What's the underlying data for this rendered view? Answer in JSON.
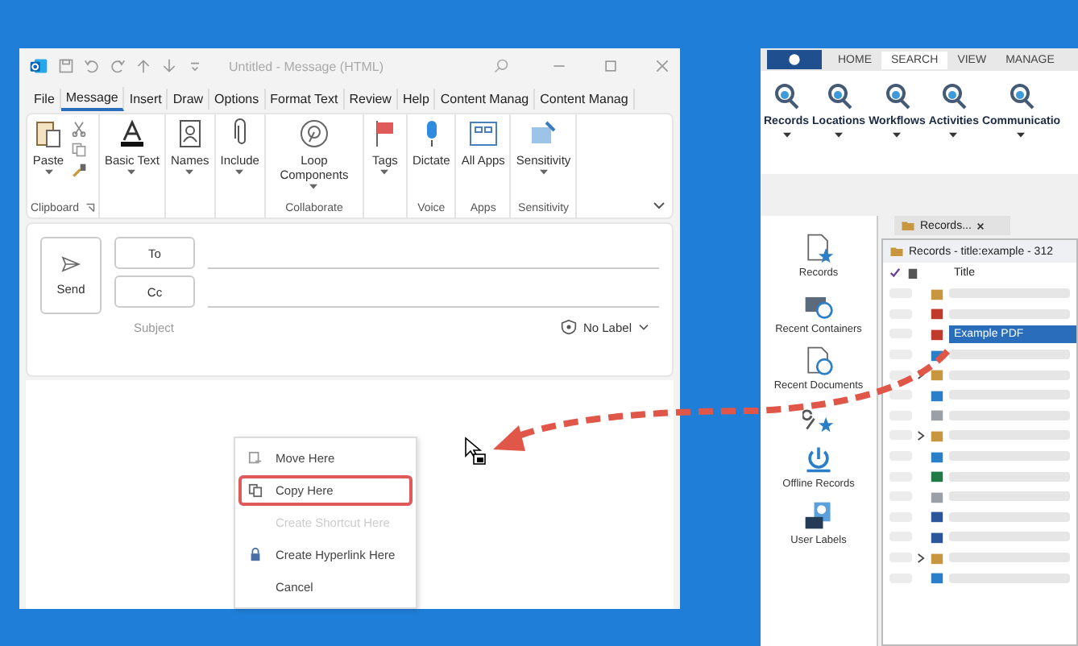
{
  "outlook": {
    "title": "Untitled - Message (HTML)",
    "tabs": [
      {
        "label": "File",
        "selected": false
      },
      {
        "label": "Message",
        "selected": true
      },
      {
        "label": "Insert",
        "selected": false
      },
      {
        "label": "Draw",
        "selected": false
      },
      {
        "label": "Options",
        "selected": false
      },
      {
        "label": "Format Text",
        "selected": false
      },
      {
        "label": "Review",
        "selected": false
      },
      {
        "label": "Help",
        "selected": false
      },
      {
        "label": "Content Manag",
        "selected": false
      },
      {
        "label": "Content Manag",
        "selected": false
      }
    ],
    "ribbon_groups": [
      {
        "label": "Clipboard",
        "launcher": true,
        "buttons": [
          {
            "kind": "large",
            "label": "Paste",
            "dropdown": true
          },
          {
            "kind": "small"
          },
          {
            "kind": "small"
          },
          {
            "kind": "small"
          }
        ]
      },
      {
        "buttons": [
          {
            "kind": "large",
            "label": "Basic Text",
            "dropdown": true
          }
        ]
      },
      {
        "buttons": [
          {
            "kind": "large",
            "label": "Names",
            "dropdown": true
          }
        ]
      },
      {
        "buttons": [
          {
            "kind": "large",
            "label": "Include",
            "dropdown": true
          }
        ]
      },
      {
        "label": "Collaborate",
        "buttons": [
          {
            "kind": "large",
            "label": "Loop Components",
            "dropdown": true
          }
        ]
      },
      {
        "buttons": [
          {
            "kind": "large",
            "label": "Tags",
            "dropdown": true
          }
        ]
      },
      {
        "label": "Voice",
        "buttons": [
          {
            "kind": "large",
            "label": "Dictate",
            "dropdown": false
          }
        ]
      },
      {
        "label": "Apps",
        "buttons": [
          {
            "kind": "large",
            "label": "All Apps",
            "dropdown": false
          }
        ]
      },
      {
        "label": "Sensitivity",
        "buttons": [
          {
            "kind": "large",
            "label": "Sensitivity",
            "dropdown": true
          }
        ]
      }
    ],
    "compose": {
      "send": "Send",
      "to": "To",
      "cc": "Cc",
      "subject": "Subject",
      "sensitivity": "No Label"
    },
    "context_menu": [
      {
        "label": "Move Here",
        "disabled": false,
        "selected": false
      },
      {
        "label": "Copy Here",
        "disabled": false,
        "selected": true
      },
      {
        "label": "Create Shortcut Here",
        "disabled": true,
        "selected": false
      },
      {
        "label": "Create Hyperlink Here",
        "disabled": false,
        "selected": false
      },
      {
        "label": "Cancel",
        "disabled": false,
        "selected": false
      }
    ]
  },
  "records_app": {
    "tabs": [
      {
        "label": "HOME",
        "selected": false
      },
      {
        "label": "SEARCH",
        "selected": true
      },
      {
        "label": "VIEW",
        "selected": false
      },
      {
        "label": "MANAGE",
        "selected": false
      }
    ],
    "find_buttons": [
      {
        "label": "Records"
      },
      {
        "label": "Locations"
      },
      {
        "label": "Workflows"
      },
      {
        "label": "Activities"
      },
      {
        "label": "Communicatio"
      }
    ],
    "favorites": [
      {
        "kind": "records",
        "label": "Records"
      },
      {
        "kind": "containers",
        "label": "Recent Containers"
      },
      {
        "kind": "documents",
        "label": "Recent Documents"
      },
      {
        "kind": "searches"
      },
      {
        "kind": "offline",
        "label": "Offline Records"
      },
      {
        "kind": "labels",
        "label": "User Labels"
      }
    ],
    "doc_tab": "Records...",
    "panel_title": "Records - title:example - 312",
    "column": "Title",
    "rows": [
      {
        "kind": "folder",
        "expandable": false,
        "selected": false
      },
      {
        "kind": "pdf",
        "expandable": false,
        "selected": false
      },
      {
        "kind": "pdf",
        "expandable": false,
        "selected": true,
        "title": "Example PDF"
      },
      {
        "kind": "mail",
        "expandable": false,
        "selected": false
      },
      {
        "kind": "folder",
        "expandable": true,
        "selected": false
      },
      {
        "kind": "mail",
        "expandable": false,
        "selected": false
      },
      {
        "kind": "file",
        "expandable": false,
        "selected": false
      },
      {
        "kind": "folder",
        "expandable": true,
        "selected": false
      },
      {
        "kind": "mail",
        "expandable": false,
        "selected": false
      },
      {
        "kind": "excel",
        "expandable": false,
        "selected": false
      },
      {
        "kind": "file",
        "expandable": false,
        "selected": false
      },
      {
        "kind": "word",
        "expandable": false,
        "selected": false
      },
      {
        "kind": "word",
        "expandable": false,
        "selected": false
      },
      {
        "kind": "folder",
        "expandable": true,
        "selected": false
      },
      {
        "kind": "mail",
        "expandable": false,
        "selected": false
      }
    ]
  }
}
